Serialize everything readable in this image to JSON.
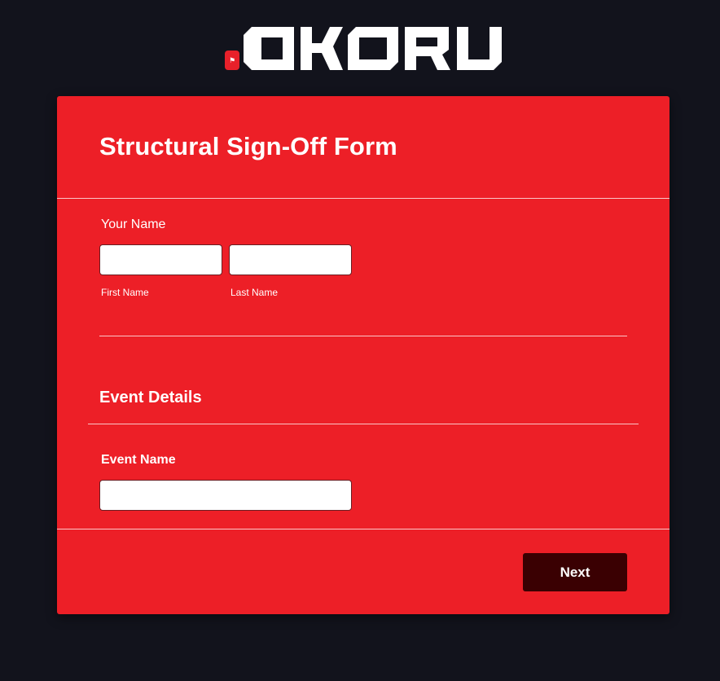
{
  "brand": {
    "logo_text": "OKORU",
    "badge_icon": "flag-icon",
    "accent_color": "#ed1f27",
    "background_color": "#12131c",
    "button_color": "#3a0002"
  },
  "form": {
    "title": "Structural Sign-Off Form",
    "name_field": {
      "label": "Your Name",
      "first": {
        "sublabel": "First Name",
        "value": "",
        "placeholder": ""
      },
      "last": {
        "sublabel": "Last Name",
        "value": "",
        "placeholder": ""
      }
    },
    "event_section": {
      "title": "Event Details",
      "event_name": {
        "label": "Event Name",
        "value": "",
        "placeholder": ""
      }
    },
    "next_label": "Next"
  }
}
